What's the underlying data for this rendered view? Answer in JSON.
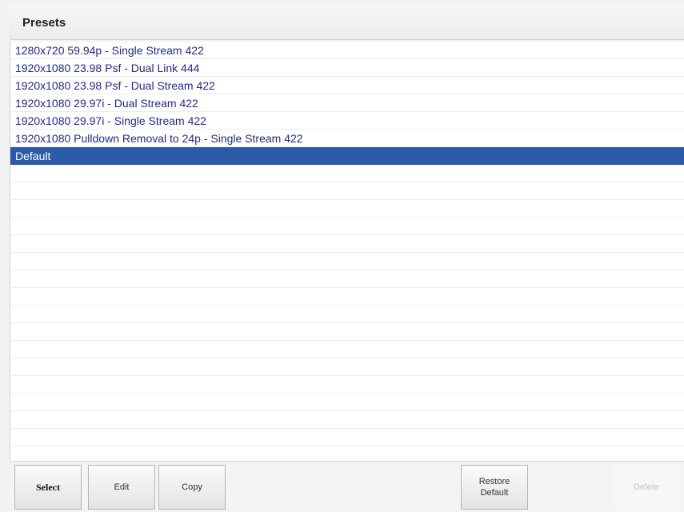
{
  "header": {
    "title": "Presets"
  },
  "presets": {
    "items": [
      {
        "label": "1280x720 59.94p - Single Stream 422",
        "selected": false
      },
      {
        "label": "1920x1080 23.98 Psf - Dual Link 444",
        "selected": false
      },
      {
        "label": "1920x1080 23.98 Psf - Dual Stream 422",
        "selected": false
      },
      {
        "label": "1920x1080 29.97i - Dual Stream 422",
        "selected": false
      },
      {
        "label": "1920x1080 29.97i - Single Stream 422",
        "selected": false
      },
      {
        "label": "1920x1080 Pulldown Removal to 24p - Single Stream 422",
        "selected": false
      },
      {
        "label": "Default",
        "selected": true
      }
    ]
  },
  "buttons": {
    "select": "Select",
    "edit": "Edit",
    "copy": "Copy",
    "restore_default": "Restore\nDefault",
    "delete": "Delete"
  },
  "colors": {
    "item_text": "#1f2a8a",
    "selection_background": "#2b5aa6"
  }
}
